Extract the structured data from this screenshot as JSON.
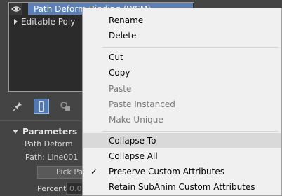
{
  "stack": {
    "modifier_label": "Path Deform Binding (WSM)",
    "base_object_label": "Editable Poly"
  },
  "parameters": {
    "title": "Parameters",
    "group_label": "Path Deform",
    "path_label": "Path: Line001",
    "pick_path_label": "Pick Pat",
    "percent_label": "Percent",
    "percent_value": "0.0"
  },
  "context_menu": {
    "items": [
      {
        "label": "Rename",
        "enabled": true
      },
      {
        "label": "Delete",
        "enabled": true
      },
      {
        "label": "Cut",
        "enabled": true
      },
      {
        "label": "Copy",
        "enabled": true
      },
      {
        "label": "Paste",
        "enabled": false
      },
      {
        "label": "Paste Instanced",
        "enabled": false
      },
      {
        "label": "Make Unique",
        "enabled": false
      },
      {
        "label": "Collapse To",
        "enabled": true,
        "highlighted": true
      },
      {
        "label": "Collapse All",
        "enabled": true
      },
      {
        "label": "Preserve Custom Attributes",
        "enabled": true,
        "checked": true
      },
      {
        "label": "Retain SubAnim Custom Attributes",
        "enabled": true
      }
    ]
  },
  "colors": {
    "panel_bg": "#444444",
    "stack_bg": "#2b2b2b",
    "selection_blue": "#5b7fb8",
    "menu_bg": "#f0f0f0",
    "menu_hover": "#d9d9d9",
    "disabled_text": "#7a7a7a"
  },
  "icons": {
    "visibility": "eye-icon",
    "expand": "triangle-right-icon",
    "pin": "pin-icon",
    "show_end_result": "show-end-result-icon",
    "make_unique": "make-unique-icon",
    "rollout_toggle": "triangle-down-icon",
    "check": "checkmark-icon"
  }
}
